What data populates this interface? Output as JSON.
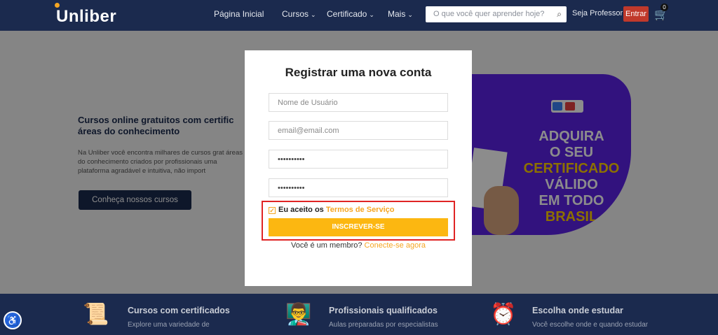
{
  "header": {
    "logo": "Unliber",
    "nav": [
      {
        "label": "Página Inicial",
        "dropdown": false
      },
      {
        "label": "Cursos",
        "dropdown": true
      },
      {
        "label": "Certificado",
        "dropdown": true
      },
      {
        "label": "Mais",
        "dropdown": true
      }
    ],
    "search_placeholder": "O que você quer aprender hoje?",
    "seja_professor": "Seja Professor",
    "entrar": "Entrar",
    "cart_count": "0"
  },
  "hero": {
    "title": "Cursos online gratuitos com certific áreas do conhecimento",
    "description": "Na Unliber você encontra milhares de cursos grat áreas do conhecimento criados por profissionais uma plataforma agradável e intuitiva, não import",
    "cta": "Conheça nossos cursos"
  },
  "promo": {
    "lines": [
      {
        "text": "ADQUIRA",
        "color": "white"
      },
      {
        "text": "O SEU",
        "color": "white"
      },
      {
        "text": "CERTIFICADO",
        "color": "yellow"
      },
      {
        "text": "VÁLIDO",
        "color": "white"
      },
      {
        "text": "EM TODO",
        "color": "mixed"
      },
      {
        "text": "BRASIL",
        "color": "yellow"
      }
    ]
  },
  "footer": {
    "features": [
      {
        "title": "Cursos com certificados",
        "desc": "Explore uma variedade de",
        "icon": "certificate-icon"
      },
      {
        "title": "Profissionais qualificados",
        "desc": "Aulas preparadas por especialistas",
        "icon": "teacher-icon"
      },
      {
        "title": "Escolha onde estudar",
        "desc": "Você escolhe onde e quando estudar",
        "icon": "alarm-clock-icon"
      }
    ]
  },
  "modal": {
    "title": "Registrar uma nova conta",
    "username_placeholder": "Nome de Usuário",
    "email_placeholder": "email@email.com",
    "password_value": "••••••••••",
    "confirm_password_value": "••••••••••",
    "accept_text": "Eu aceito os ",
    "terms_link": "Termos de Serviço",
    "submit": "INSCREVER-SE",
    "member_text": "Você é um membro? ",
    "login_link": "Conecte-se agora"
  },
  "colors": {
    "navy": "#1b2a4e",
    "accent": "#fcb711",
    "entrar": "#c0392b",
    "highlight": "#e02424",
    "promo": "#5b21e6"
  }
}
